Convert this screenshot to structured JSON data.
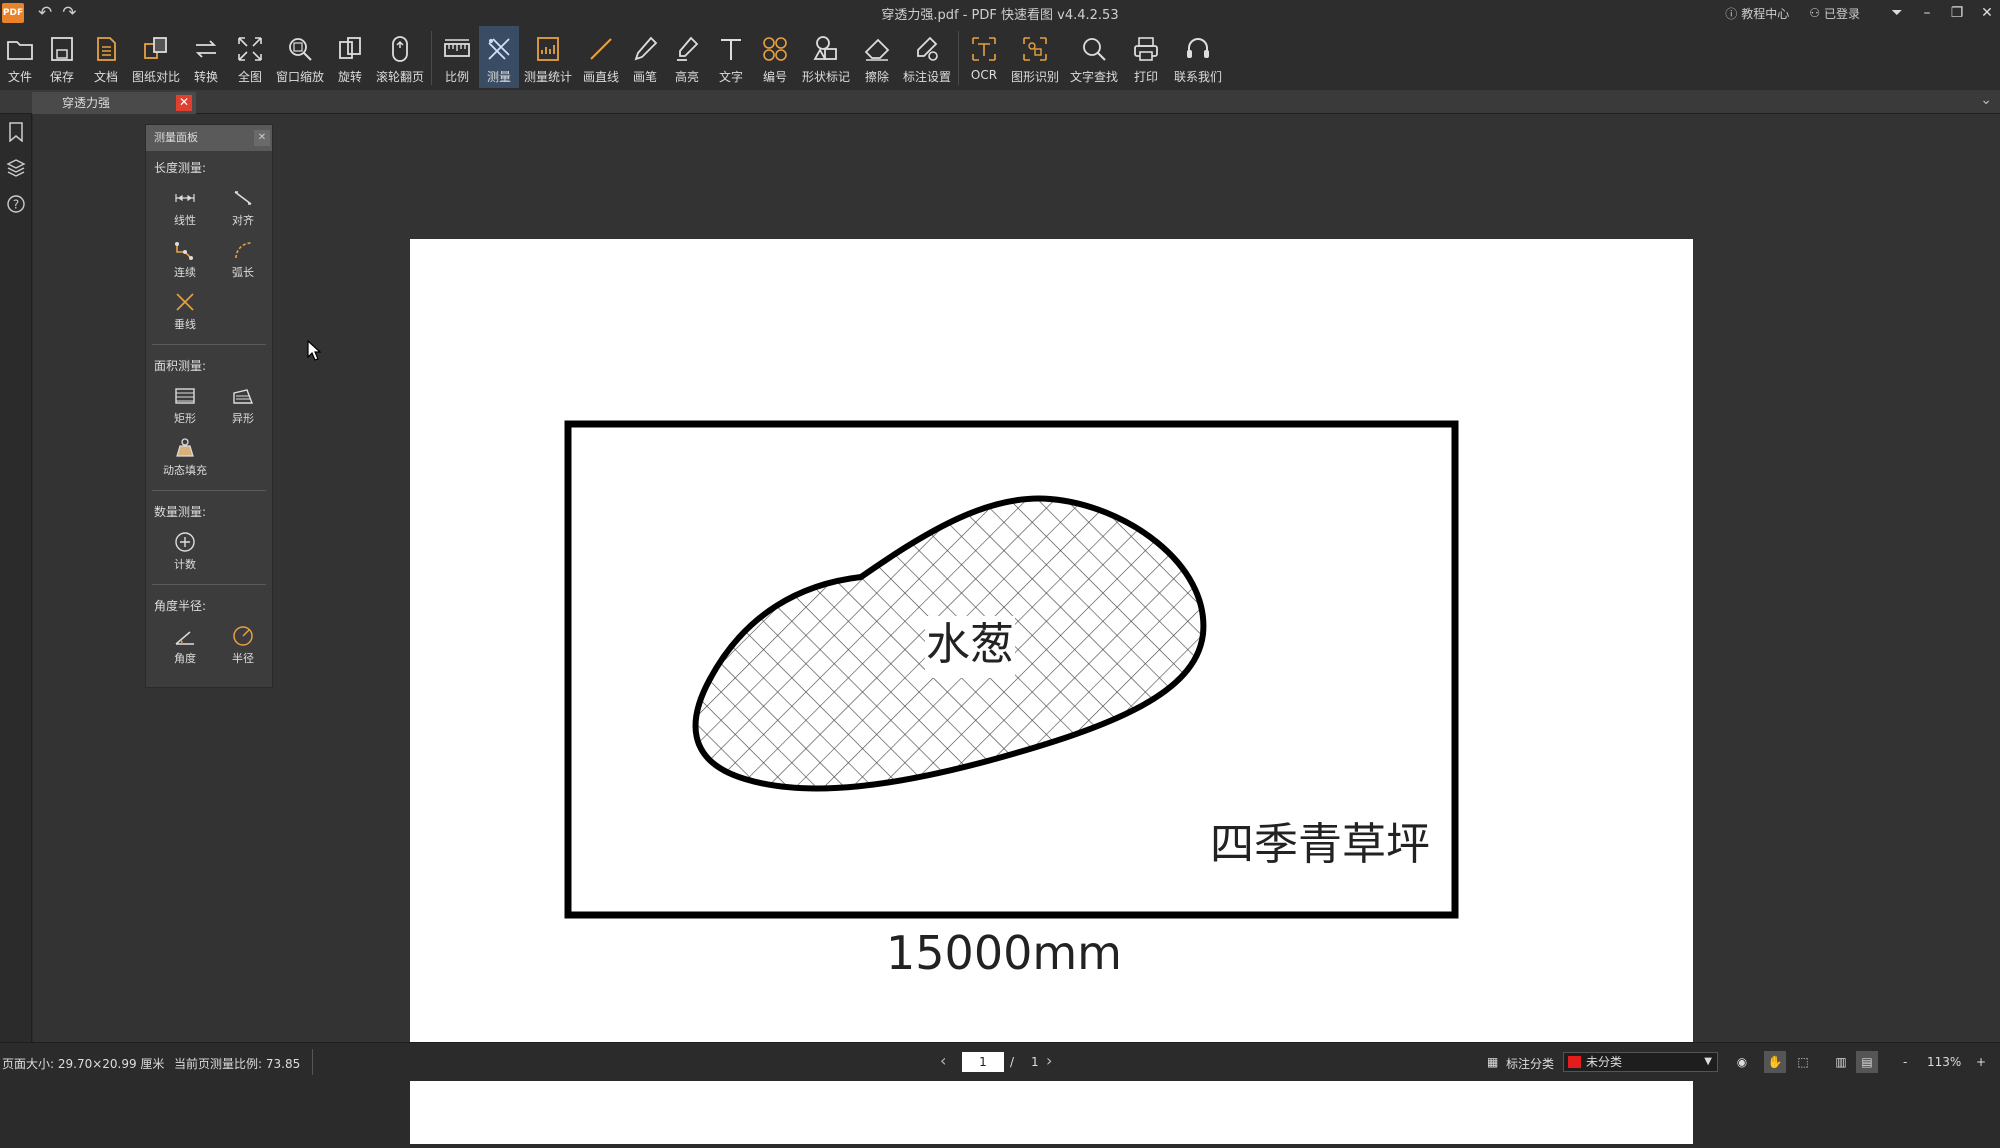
{
  "titlebar": {
    "title": "穿透力强.pdf - PDF 快速看图 v4.4.2.53",
    "logo": "PDF",
    "help_label": "教程中心",
    "login_label": "已登录"
  },
  "toolbar": [
    {
      "label": "文件",
      "icon": "folder-icon"
    },
    {
      "label": "保存",
      "icon": "save-icon"
    },
    {
      "label": "文档",
      "icon": "document-icon"
    },
    {
      "label": "图纸对比",
      "icon": "compare-icon"
    },
    {
      "label": "转换",
      "icon": "convert-icon"
    },
    {
      "label": "全图",
      "icon": "fullview-icon"
    },
    {
      "label": "窗口缩放",
      "icon": "zoom-window-icon"
    },
    {
      "label": "旋转",
      "icon": "rotate-icon"
    },
    {
      "label": "滚轮翻页",
      "icon": "scroll-wheel-icon"
    },
    {
      "label": "比例",
      "icon": "scale-icon"
    },
    {
      "label": "测量",
      "icon": "measure-icon"
    },
    {
      "label": "测量统计",
      "icon": "measure-stats-icon"
    },
    {
      "label": "画直线",
      "icon": "line-icon"
    },
    {
      "label": "画笔",
      "icon": "pen-icon"
    },
    {
      "label": "高亮",
      "icon": "highlight-icon"
    },
    {
      "label": "文字",
      "icon": "text-icon"
    },
    {
      "label": "编号",
      "icon": "number-icon"
    },
    {
      "label": "形状标记",
      "icon": "shape-mark-icon"
    },
    {
      "label": "擦除",
      "icon": "eraser-icon"
    },
    {
      "label": "标注设置",
      "icon": "annotation-settings-icon"
    },
    {
      "label": "OCR",
      "icon": "ocr-icon"
    },
    {
      "label": "图形识别",
      "icon": "shape-recognition-icon"
    },
    {
      "label": "文字查找",
      "icon": "text-search-icon"
    },
    {
      "label": "打印",
      "icon": "print-icon"
    },
    {
      "label": "联系我们",
      "icon": "headset-icon"
    }
  ],
  "tab": {
    "label": "穿透力强",
    "close": "✕"
  },
  "panel": {
    "title": "测量面板",
    "sections": [
      {
        "title": "长度测量:",
        "items": [
          "线性",
          "对齐",
          "连续",
          "弧长",
          "垂线"
        ]
      },
      {
        "title": "面积测量:",
        "items": [
          "矩形",
          "异形",
          "动态填充"
        ]
      },
      {
        "title": "数量测量:",
        "items": [
          "计数"
        ]
      },
      {
        "title": "角度半径:",
        "items": [
          "角度",
          "半径"
        ]
      }
    ]
  },
  "drawing": {
    "blob_label": "水葱",
    "corner_label": "四季青草坪",
    "dimension": "15000mm"
  },
  "status": {
    "page_size": "页面大小: 29.70×20.99 厘米",
    "scale": "当前页测量比例: 73.85",
    "page_current": "1",
    "page_sep": "/",
    "page_total": "1",
    "category_label": "标注分类",
    "category_value": "未分类",
    "zoom": "113%",
    "zoom_minus": "-",
    "zoom_plus": "+"
  },
  "colors": {
    "accent": "#3a4c63",
    "category_swatch": "#e31c1c",
    "tab_close": "#e0402f"
  }
}
